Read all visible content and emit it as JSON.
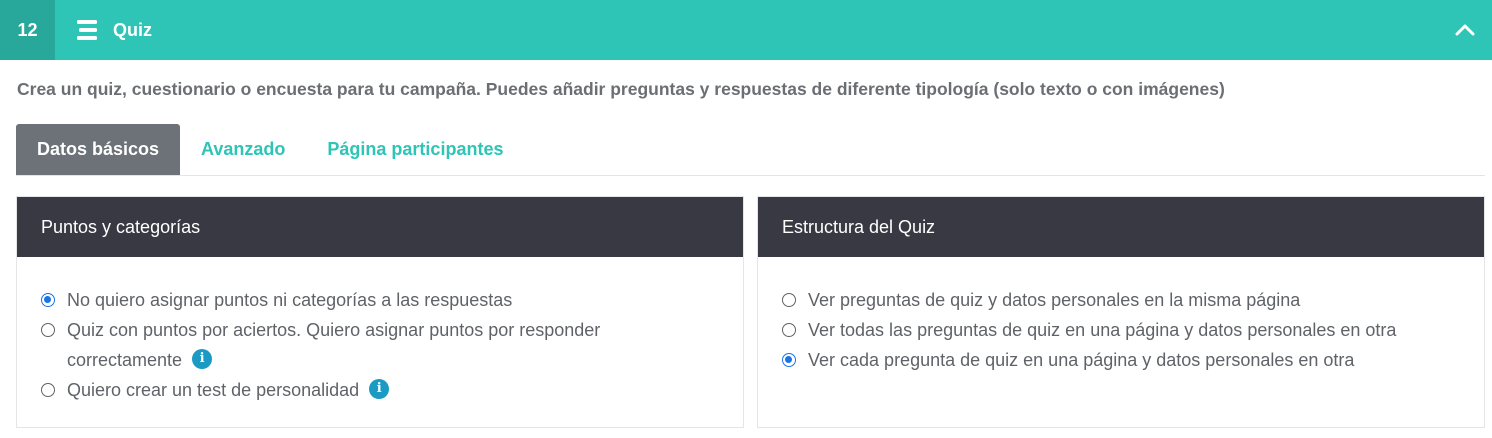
{
  "header": {
    "step_number": "12",
    "title": "Quiz"
  },
  "description": "Crea un quiz, cuestionario o encuesta para tu campaña. Puedes añadir preguntas y respuestas de diferente tipología (solo texto o con imágenes)",
  "tabs": [
    {
      "label": "Datos básicos",
      "active": true
    },
    {
      "label": "Avanzado",
      "active": false
    },
    {
      "label": "Página participantes",
      "active": false
    }
  ],
  "points_panel": {
    "title": "Puntos y categorías",
    "options": [
      {
        "label": "No quiero asignar puntos ni categorías a las respuestas",
        "checked": true
      },
      {
        "label_line1": "Quiz con puntos por aciertos. Quiero asignar puntos por responder",
        "label_line2": "correctamente",
        "checked": false,
        "info": true
      },
      {
        "label": "Quiero crear un test de personalidad",
        "checked": false,
        "info": true
      }
    ]
  },
  "structure_panel": {
    "title": "Estructura del Quiz",
    "options": [
      {
        "label": "Ver preguntas de quiz y datos personales en la misma página",
        "checked": false
      },
      {
        "label": "Ver todas las preguntas de quiz en una página y datos personales en otra",
        "checked": false
      },
      {
        "label": "Ver cada pregunta de quiz en una página y datos personales en otra",
        "checked": true
      }
    ]
  },
  "colors": {
    "accent": "#2ec5b6",
    "accent_dark": "#28a89b",
    "panel_header": "#393943",
    "active_tab": "#6c7278",
    "radio_checked": "#1a73e8",
    "info": "#1b9bc4"
  },
  "icons": {
    "menu": "menu-lines-icon",
    "collapse": "chevron-up-icon",
    "info": "info-icon"
  }
}
